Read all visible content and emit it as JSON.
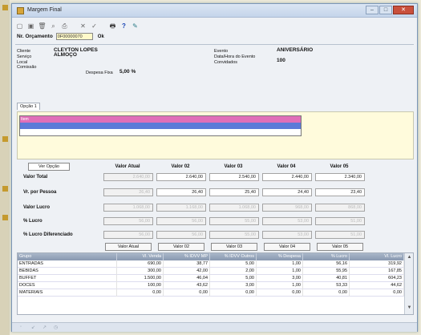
{
  "window": {
    "title": "Margem Final",
    "controls": {
      "minimize": "–",
      "maximize": "□",
      "close": "✕"
    }
  },
  "toolbar": {
    "icons": [
      "new-doc",
      "copy-doc",
      "delete",
      "find",
      "print-preview",
      "cancel",
      "confirm",
      "print",
      "help",
      "tools"
    ],
    "glyphs": [
      "▢",
      "▣",
      "🗑",
      "⌕",
      "⎙",
      "✕",
      "✓",
      "🖶",
      "?",
      "✎"
    ]
  },
  "orcamento": {
    "label": "Nr. Orçamento",
    "value": "0F00000070",
    "button": "Ok"
  },
  "info_left": {
    "cliente_label": "Cliente",
    "cliente_value": "CLEYTON LOPES",
    "servico_label": "Serviço",
    "servico_value": "ALMOÇO",
    "local_label": "Local",
    "comissao_label": "Comissão",
    "despesa_label": "Despesa Fixa",
    "despesa_value": "5,00 %"
  },
  "info_right": {
    "evento_label": "Evento",
    "evento_value": "ANIVERSÁRIO",
    "data_label": "Data/Hora do Evento",
    "convidados_label": "Convidados",
    "convidados_value": "100"
  },
  "tab": {
    "label": "Opção 1"
  },
  "list": {
    "first_item": "Item"
  },
  "grid": {
    "ver_opcao": "Ver Opção",
    "columns": [
      "Valor Atual",
      "Valor 02",
      "Valor 03",
      "Valor 04",
      "Valor 05"
    ],
    "row_labels": [
      "Valor Total",
      "Vr. por Pessoa",
      "Valor Lucro",
      "% Lucro",
      "% Lucro Diferenciado"
    ],
    "values": [
      [
        "2.640,00",
        "2.640,00",
        "2.540,00",
        "2.440,00",
        "2.340,00"
      ],
      [
        "26,40",
        "26,40",
        "25,40",
        "24,40",
        "23,40"
      ],
      [
        "1.068,00",
        "1.168,00",
        "1.068,00",
        "968,00",
        "868,00"
      ],
      [
        "56,00",
        "56,00",
        "55,00",
        "53,00",
        "51,00"
      ],
      [
        "56,00",
        "56,00",
        "55,00",
        "53,00",
        "51,00"
      ]
    ],
    "buttons": [
      "Valor Atual",
      "Valor 02",
      "Valor 03",
      "Valor 04",
      "Valor 05"
    ]
  },
  "table": {
    "headers": [
      "Grupo",
      "Vl. Venda",
      "% IDVV MP",
      "% IDVV Outros",
      "% Despesa",
      "% Lucro",
      "Vl. Lucro"
    ],
    "rows": [
      [
        "ENTRADAS",
        "690,00",
        "38,77",
        "5,00",
        "1,00",
        "56,16",
        "319,92"
      ],
      [
        "BEBIDAS",
        "300,00",
        "42,00",
        "2,00",
        "1,00",
        "55,95",
        "167,85"
      ],
      [
        "BUFFET",
        "1.500,00",
        "46,04",
        "5,00",
        "3,00",
        "40,81",
        "604,23"
      ],
      [
        "DOCES",
        "100,00",
        "43,62",
        "3,00",
        "1,00",
        "53,33",
        "44,62"
      ],
      [
        "MATERIAIS",
        "0,00",
        "0,00",
        "0,00",
        "0,00",
        "0,00",
        "0,00"
      ]
    ]
  },
  "statusbar": {
    "items": [
      "◦",
      "↙",
      "↗",
      "◷"
    ]
  }
}
